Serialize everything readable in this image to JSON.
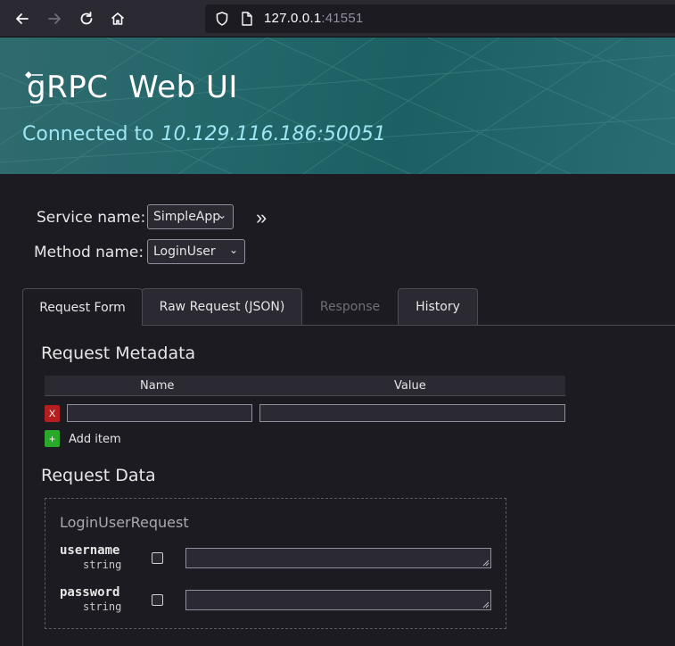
{
  "browser": {
    "url_host": "127.0.0.1",
    "url_port": ":41551"
  },
  "header": {
    "title": "gRPC  Web UI",
    "connected_label": "Connected to",
    "address": "10.129.116.186:50051"
  },
  "form": {
    "service_label": "Service name:",
    "service_value": "SimpleApp",
    "method_label": "Method name:",
    "method_value": "LoginUser",
    "expand_glyph": "»"
  },
  "tabs": [
    {
      "label": "Request Form",
      "state": "active"
    },
    {
      "label": "Raw Request (JSON)",
      "state": "normal"
    },
    {
      "label": "Response",
      "state": "disabled"
    },
    {
      "label": "History",
      "state": "normal"
    }
  ],
  "metadata": {
    "heading": "Request Metadata",
    "col_name": "Name",
    "col_value": "Value",
    "remove_label": "X",
    "add_label": "+",
    "add_item": "Add item"
  },
  "request": {
    "heading": "Request Data",
    "message": "LoginUserRequest",
    "fields": [
      {
        "name": "username",
        "type": "string"
      },
      {
        "name": "password",
        "type": "string"
      }
    ]
  }
}
